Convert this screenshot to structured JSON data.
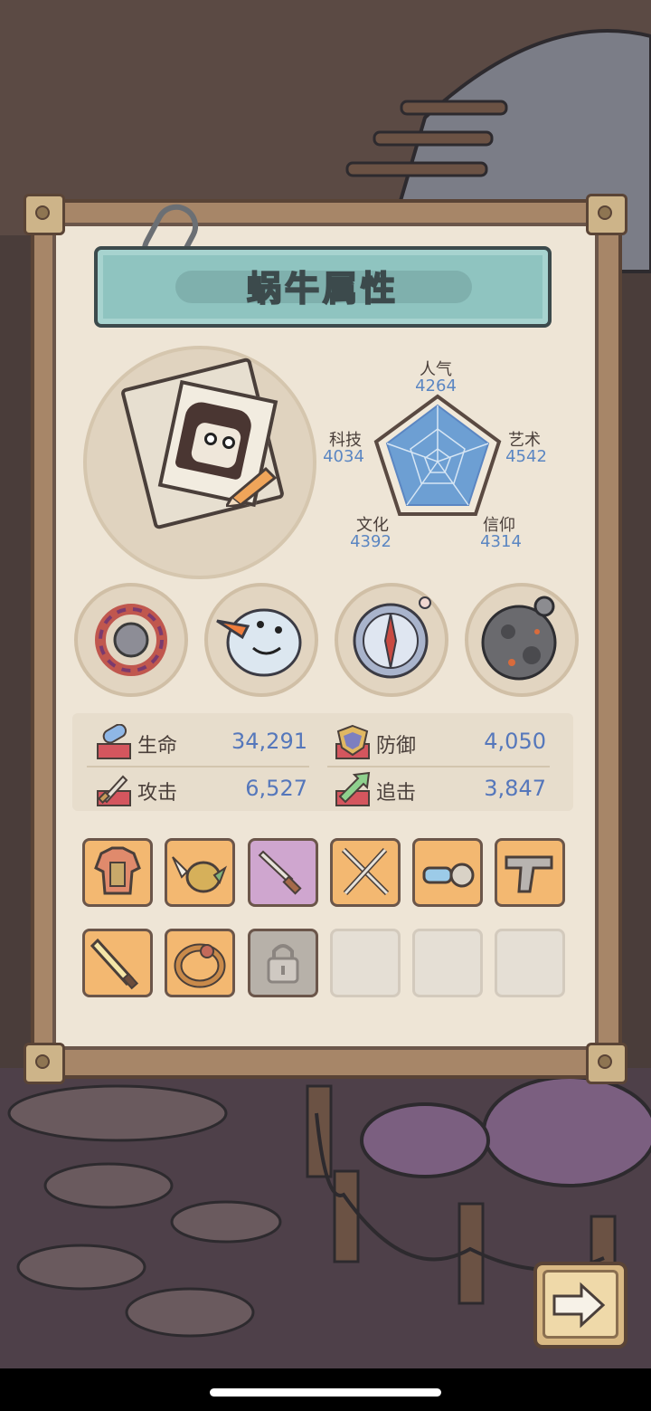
{
  "screen_title": "蜗牛属性",
  "radar": {
    "stats": [
      {
        "label": "人气",
        "value": "4264"
      },
      {
        "label": "艺术",
        "value": "4542"
      },
      {
        "label": "信仰",
        "value": "4314"
      },
      {
        "label": "文化",
        "value": "4392"
      },
      {
        "label": "科技",
        "value": "4034"
      }
    ]
  },
  "relics": [
    {
      "icon": "thorny-vine-ring-icon"
    },
    {
      "icon": "snowman-head-icon"
    },
    {
      "icon": "compass-icon"
    },
    {
      "icon": "meteorite-icon"
    }
  ],
  "stats": [
    {
      "label": "生命",
      "value": "34,291",
      "icon": "health-pill-icon"
    },
    {
      "label": "防御",
      "value": "4,050",
      "icon": "shield-icon"
    },
    {
      "label": "攻击",
      "value": "6,527",
      "icon": "sword-stat-icon"
    },
    {
      "label": "追击",
      "value": "3,847",
      "icon": "chase-arrow-icon"
    }
  ],
  "equipment": [
    {
      "icon": "armor-icon",
      "state": "orange"
    },
    {
      "icon": "winged-helmet-icon",
      "state": "orange"
    },
    {
      "icon": "dagger-icon",
      "state": "purple"
    },
    {
      "icon": "crossed-swords-icon",
      "state": "orange"
    },
    {
      "icon": "goggles-icon",
      "state": "orange"
    },
    {
      "icon": "pistol-icon",
      "state": "orange"
    },
    {
      "icon": "baton-icon",
      "state": "orange"
    },
    {
      "icon": "ring-icon",
      "state": "orange"
    },
    {
      "icon": "lock-icon",
      "state": "locked"
    },
    {
      "icon": "",
      "state": "empty"
    },
    {
      "icon": "",
      "state": "empty"
    },
    {
      "icon": "",
      "state": "empty"
    }
  ],
  "colors": {
    "stat_value": "#5577bb",
    "radar_value": "#5b86c2",
    "slot_orange": "#f3b871",
    "slot_purple": "#cfa6cf",
    "title_banner": "#8fc4c0"
  },
  "next_button": {
    "icon": "arrow-right-icon"
  }
}
